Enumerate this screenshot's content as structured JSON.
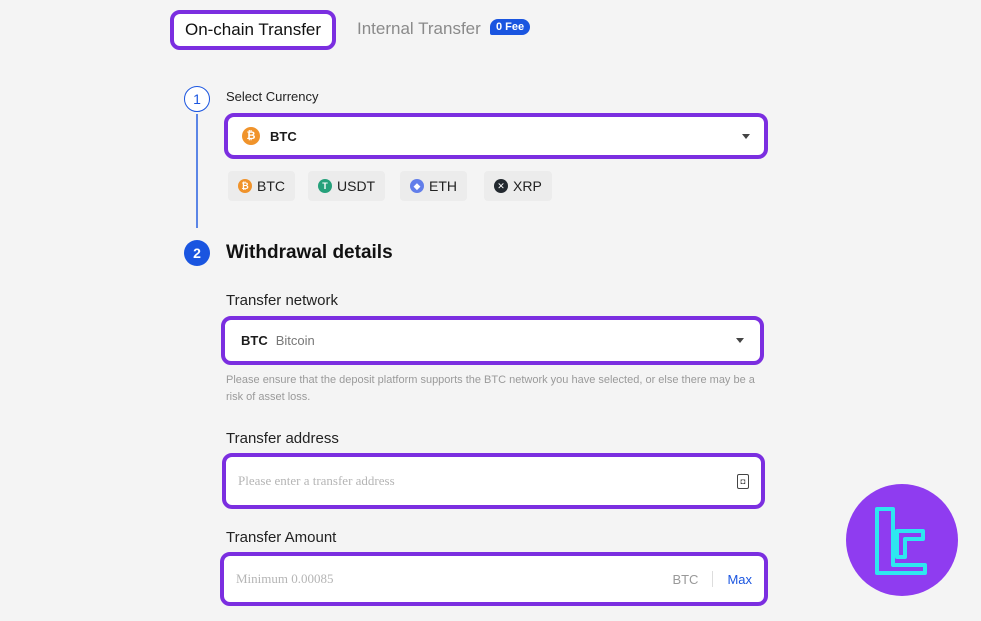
{
  "tabs": {
    "onchain_label": "On-chain Transfer",
    "internal_label": "Internal Transfer",
    "fee_badge": "0 Fee"
  },
  "steps": {
    "step1_number": "1",
    "step2_number": "2"
  },
  "currency": {
    "label": "Select Currency",
    "selected": "BTC",
    "chips": [
      "BTC",
      "USDT",
      "ETH",
      "XRP"
    ]
  },
  "details": {
    "heading": "Withdrawal details",
    "network_label": "Transfer network",
    "network_code": "BTC",
    "network_name": "Bitcoin",
    "network_note": "Please ensure that the deposit platform supports the BTC network you have selected, or else there may be a risk of asset loss.",
    "address_label": "Transfer address",
    "address_placeholder": "Please enter a transfer address",
    "amount_label": "Transfer Amount",
    "amount_placeholder": "Minimum 0.00085",
    "amount_unit": "BTC",
    "max_label": "Max"
  },
  "colors": {
    "highlight": "#7b2ee0",
    "accent": "#1a55e0",
    "btc": "#f0932b",
    "usdt": "#26a17b",
    "eth": "#627eea",
    "xrp": "#23292f",
    "logo_bg": "#8f3cf0",
    "logo_fg": "#2ee6f0"
  },
  "icons": {
    "address_book": "address-book-icon",
    "dropdown": "chevron-down-icon"
  }
}
